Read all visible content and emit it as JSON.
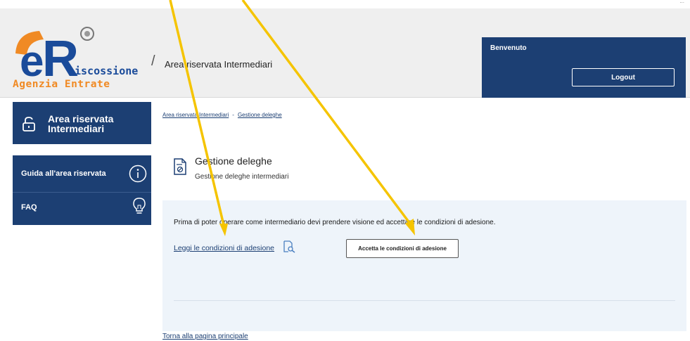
{
  "topstrip": {
    "text": "..."
  },
  "header": {
    "logo_sub": "Agenzia Entrate",
    "logo_word": "iscossione",
    "separator": "/",
    "title": "Area riservata Intermediari"
  },
  "welcome": {
    "label": "Benvenuto",
    "logout": "Logout"
  },
  "sidebar": {
    "main_label": "Area riservata Intermediari",
    "items": [
      {
        "label": "Guida all'area riservata",
        "icon": "info-icon"
      },
      {
        "label": "FAQ",
        "icon": "lightbulb-icon"
      }
    ]
  },
  "breadcrumb": {
    "home": "Area riservata Intermediari",
    "sep": "-",
    "current": "Gestione deleghe"
  },
  "page": {
    "title": "Gestione deleghe",
    "subtitle": "Gestione deleghe intermediari"
  },
  "panel": {
    "message": "Prima di poter operare come intermediario devi prendere visione ed accettare le condizioni di adesione.",
    "read_link": "Leggi le condizioni di adesione",
    "accept_button": "Accetta le condizioni di adesione"
  },
  "footer": {
    "back_link": "Torna alla pagina principale"
  },
  "colors": {
    "primary": "#1c3f73",
    "panel": "#eef4fa",
    "arrow": "#f5c400",
    "logo_orange": "#f08a24",
    "logo_blue": "#1a4b9a"
  }
}
